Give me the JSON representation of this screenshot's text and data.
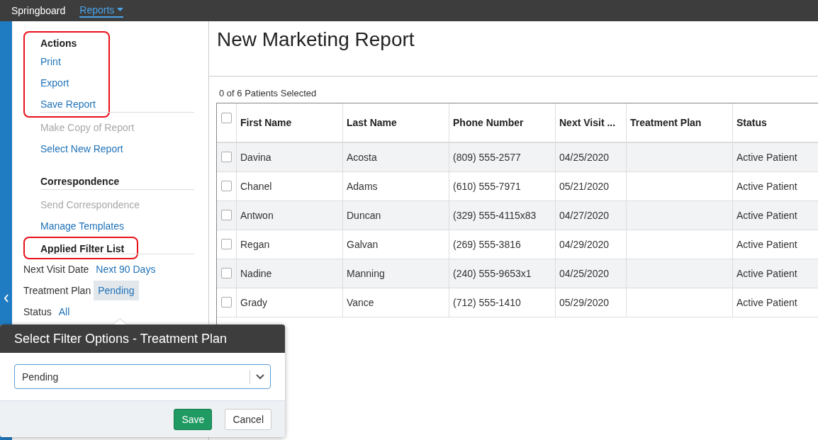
{
  "top_bar": {
    "brand": "Springboard",
    "menu": {
      "label": "Reports",
      "selected": true
    }
  },
  "sidebar": {
    "sections": [
      {
        "title": "Actions",
        "annotated": true,
        "items": [
          {
            "label": "Print",
            "disabled": false,
            "annotated": true
          },
          {
            "label": "Export",
            "disabled": false,
            "annotated": true
          },
          {
            "label": "Save Report",
            "disabled": false,
            "annotated": true
          },
          {
            "label": "Make Copy of Report",
            "disabled": true,
            "annotated": false
          },
          {
            "label": "Select New Report",
            "disabled": false,
            "annotated": false
          }
        ]
      },
      {
        "title": "Correspondence",
        "annotated": false,
        "items": [
          {
            "label": "Send Correspondence",
            "disabled": true,
            "annotated": false
          },
          {
            "label": "Manage Templates",
            "disabled": false,
            "annotated": false
          }
        ]
      },
      {
        "title": "Applied Filter List",
        "annotated": true
      }
    ],
    "filters": [
      {
        "name": "Next Visit Date",
        "value": "Next 90 Days",
        "selected": false
      },
      {
        "name": "Treatment Plan",
        "value": "Pending",
        "selected": true
      },
      {
        "name": "Status",
        "value": "All",
        "selected": false
      }
    ]
  },
  "report": {
    "title": "New Marketing Report",
    "selection_count": "0 of 6 Patients Selected",
    "table": {
      "header_checked": false,
      "columns": [
        "First Name",
        "Last Name",
        "Phone Number",
        "Next Visit ...",
        "Treatment Plan",
        "Status"
      ],
      "rows": [
        {
          "checked": false,
          "cells": [
            "Davina",
            "Acosta",
            "(809) 555-2577",
            "04/25/2020",
            "",
            "Active Patient"
          ]
        },
        {
          "checked": false,
          "cells": [
            "Chanel",
            "Adams",
            "(610) 555-7971",
            "05/21/2020",
            "",
            "Active Patient"
          ]
        },
        {
          "checked": false,
          "cells": [
            "Antwon",
            "Duncan",
            "(329) 555-4115x83",
            "04/27/2020",
            "",
            "Active Patient"
          ]
        },
        {
          "checked": false,
          "cells": [
            "Regan",
            "Galvan",
            "(269) 555-3816",
            "04/29/2020",
            "",
            "Active Patient"
          ]
        },
        {
          "checked": false,
          "cells": [
            "Nadine",
            "Manning",
            "(240) 555-9653x1",
            "04/25/2020",
            "",
            "Active Patient"
          ]
        },
        {
          "checked": false,
          "cells": [
            "Grady",
            "Vance",
            "(712) 555-1410",
            "05/29/2020",
            "",
            "Active Patient"
          ]
        }
      ]
    }
  },
  "dialog": {
    "title": "Select Filter Options - Treatment Plan",
    "select_value": "Pending",
    "buttons": [
      {
        "label": "Save",
        "kind": "primary"
      },
      {
        "label": "Cancel",
        "kind": "secondary"
      }
    ]
  }
}
